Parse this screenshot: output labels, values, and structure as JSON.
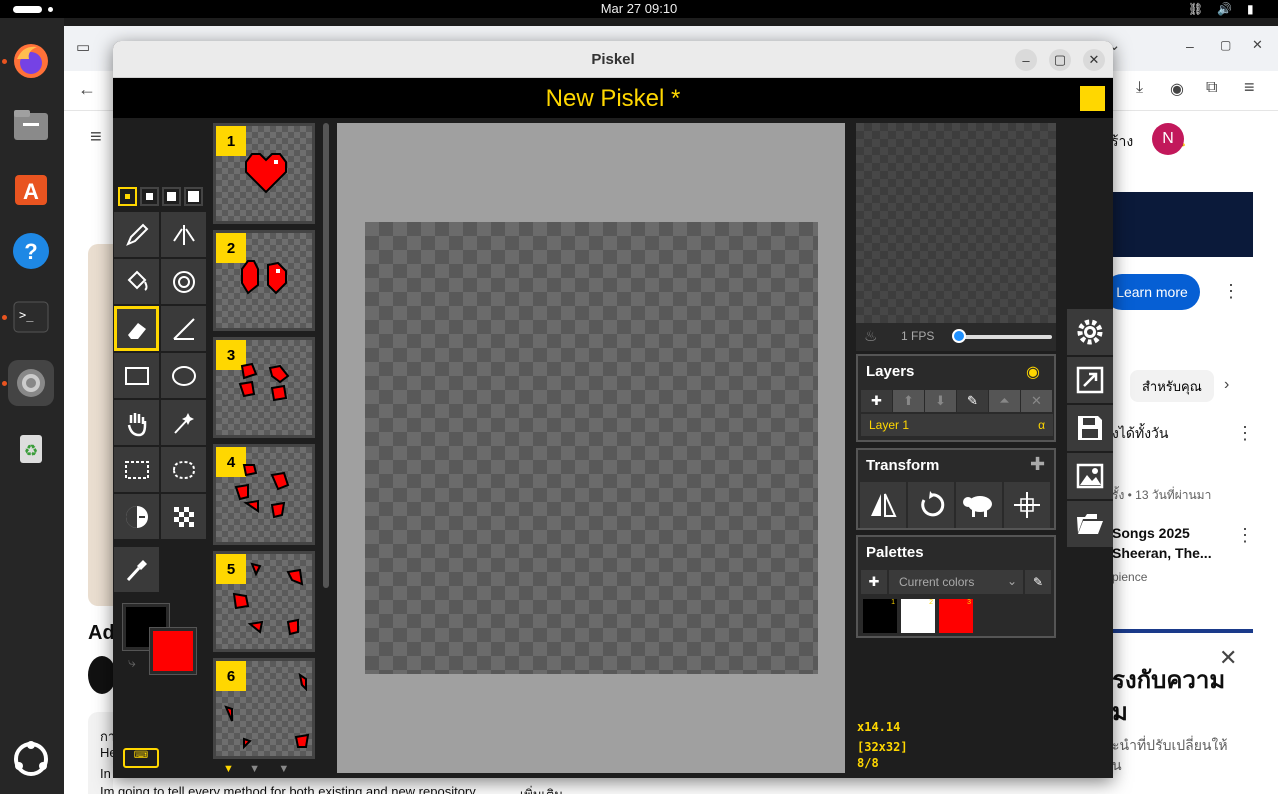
{
  "topbar": {
    "datetime": "Mar 27  09:10"
  },
  "dock": {
    "items": [
      "firefox-icon",
      "files-icon",
      "app-center-icon",
      "help-icon",
      "terminal-icon",
      "settings-icon",
      "trash-icon",
      "show-apps-icon"
    ]
  },
  "browser": {
    "create_label": "ร้าง",
    "avatar_letter": "N",
    "learn_more": "Learn more",
    "chip_label": "สำหรับคุณ",
    "video1_title": "งได้ทั้งวัน",
    "video1_meta": "รั้ง • 13 วันที่ผ่านมา",
    "video2_title_1": "Songs 2025",
    "video2_title_2": "Sheeran, The...",
    "video2_channel": "pience",
    "ad_heading_1": "รงกับความ",
    "ad_heading_2": "ม",
    "ad_sub_1": "ะนำที่ปรับเปลี่ยนให้",
    "ad_sub_2": "น",
    "left_title": "Ad",
    "desc_1": "กา",
    "desc_2": "He",
    "desc_3": "In",
    "desc_4": "Im going to tell every method for both existing and new repository.",
    "more": "...เพิ่มเติม"
  },
  "piskel": {
    "window_title": "Piskel",
    "doc_title": "New Piskel *",
    "fps_label": "1 FPS",
    "fps_value": 1,
    "layers_title": "Layers",
    "layer_name": "Layer 1",
    "layer_alpha": "α",
    "transform_title": "Transform",
    "palettes_title": "Palettes",
    "palette_select": "Current colors",
    "swatch_nums": [
      "1",
      "2",
      "3"
    ],
    "frames": [
      "1",
      "2",
      "3",
      "4",
      "5",
      "6"
    ],
    "coords": "x14.14",
    "size": "[32x32]",
    "frame_count": "8/8",
    "colors": {
      "primary": "#000000",
      "secondary": "#ff0000",
      "accent": "#ffd700"
    }
  }
}
